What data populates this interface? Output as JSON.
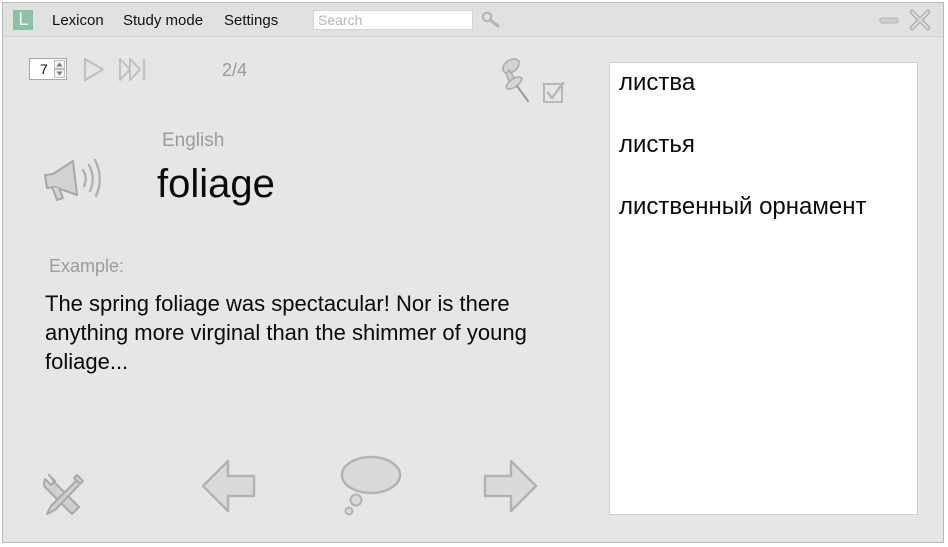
{
  "app": {
    "logo_letter": "L",
    "logo_color": "#88c4a1"
  },
  "menu": {
    "items": [
      "Lexicon",
      "Study mode",
      "Settings"
    ]
  },
  "search": {
    "placeholder": "Search",
    "value": ""
  },
  "controls": {
    "interval": "7",
    "counter": "2/4"
  },
  "card": {
    "language": "English",
    "word": "foliage",
    "example_label": "Example:",
    "example_text": "The spring foliage was spectacular! Nor is there anything more virginal than the shimmer of young foliage..."
  },
  "translations": [
    "листва",
    "листья",
    "лиственный орнамент"
  ],
  "icons": {
    "titlebar": [
      "app-logo",
      "search-icon",
      "minimize-icon",
      "close-icon"
    ],
    "toolbar": [
      "play-icon",
      "skip-to-end-icon",
      "pin-icon",
      "checkbox-icon"
    ],
    "card": [
      "speaker-icon"
    ],
    "bottom": [
      "tools-icon",
      "back-arrow-icon",
      "speech-bubble-icon",
      "forward-arrow-icon"
    ]
  }
}
